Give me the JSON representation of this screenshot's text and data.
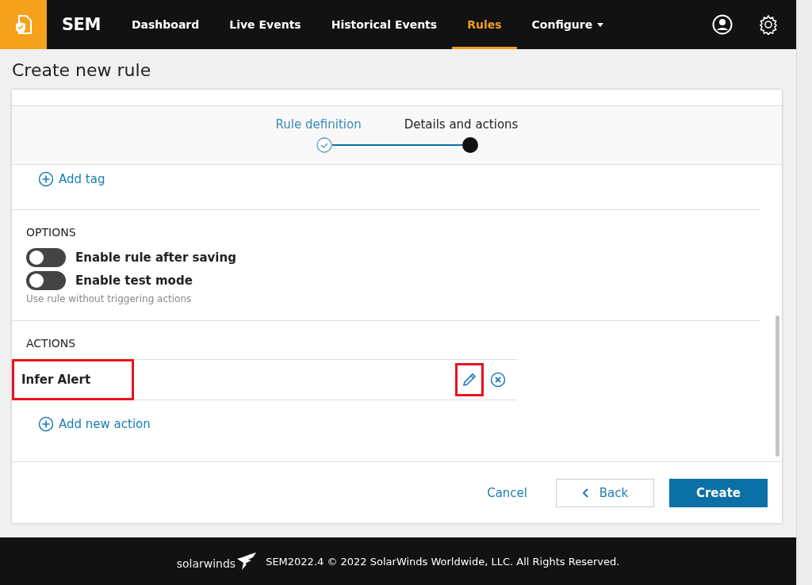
{
  "navbar": {
    "brand": "SEM",
    "items": [
      {
        "label": "Dashboard",
        "selected": false,
        "dropdown": false
      },
      {
        "label": "Live Events",
        "selected": false,
        "dropdown": false
      },
      {
        "label": "Historical Events",
        "selected": false,
        "dropdown": false
      },
      {
        "label": "Rules",
        "selected": true,
        "dropdown": false
      },
      {
        "label": "Configure",
        "selected": false,
        "dropdown": true
      }
    ]
  },
  "page_title": "Create new rule",
  "stepper": [
    {
      "label": "Rule definition",
      "completed": true,
      "selected": false
    },
    {
      "label": "Details and actions",
      "completed": false,
      "selected": true
    }
  ],
  "add_tag": "Add tag",
  "options": {
    "heading": "OPTIONS",
    "toggles": [
      {
        "label": "Enable rule after saving",
        "on": false
      },
      {
        "label": "Enable test mode",
        "on": false,
        "hint": "Use rule without triggering actions"
      }
    ]
  },
  "actions": {
    "heading": "ACTIONS",
    "items": [
      {
        "name": "Infer Alert",
        "name_highlighted": true,
        "edit_highlighted": true
      }
    ],
    "add": "Add new action"
  },
  "buttons": {
    "cancel": "Cancel",
    "back": "Back",
    "create": "Create"
  },
  "footer": {
    "logo": "solarwinds",
    "text": "SEM2022.4 © 2022 SolarWinds Worldwide, LLC. All Rights Reserved."
  }
}
